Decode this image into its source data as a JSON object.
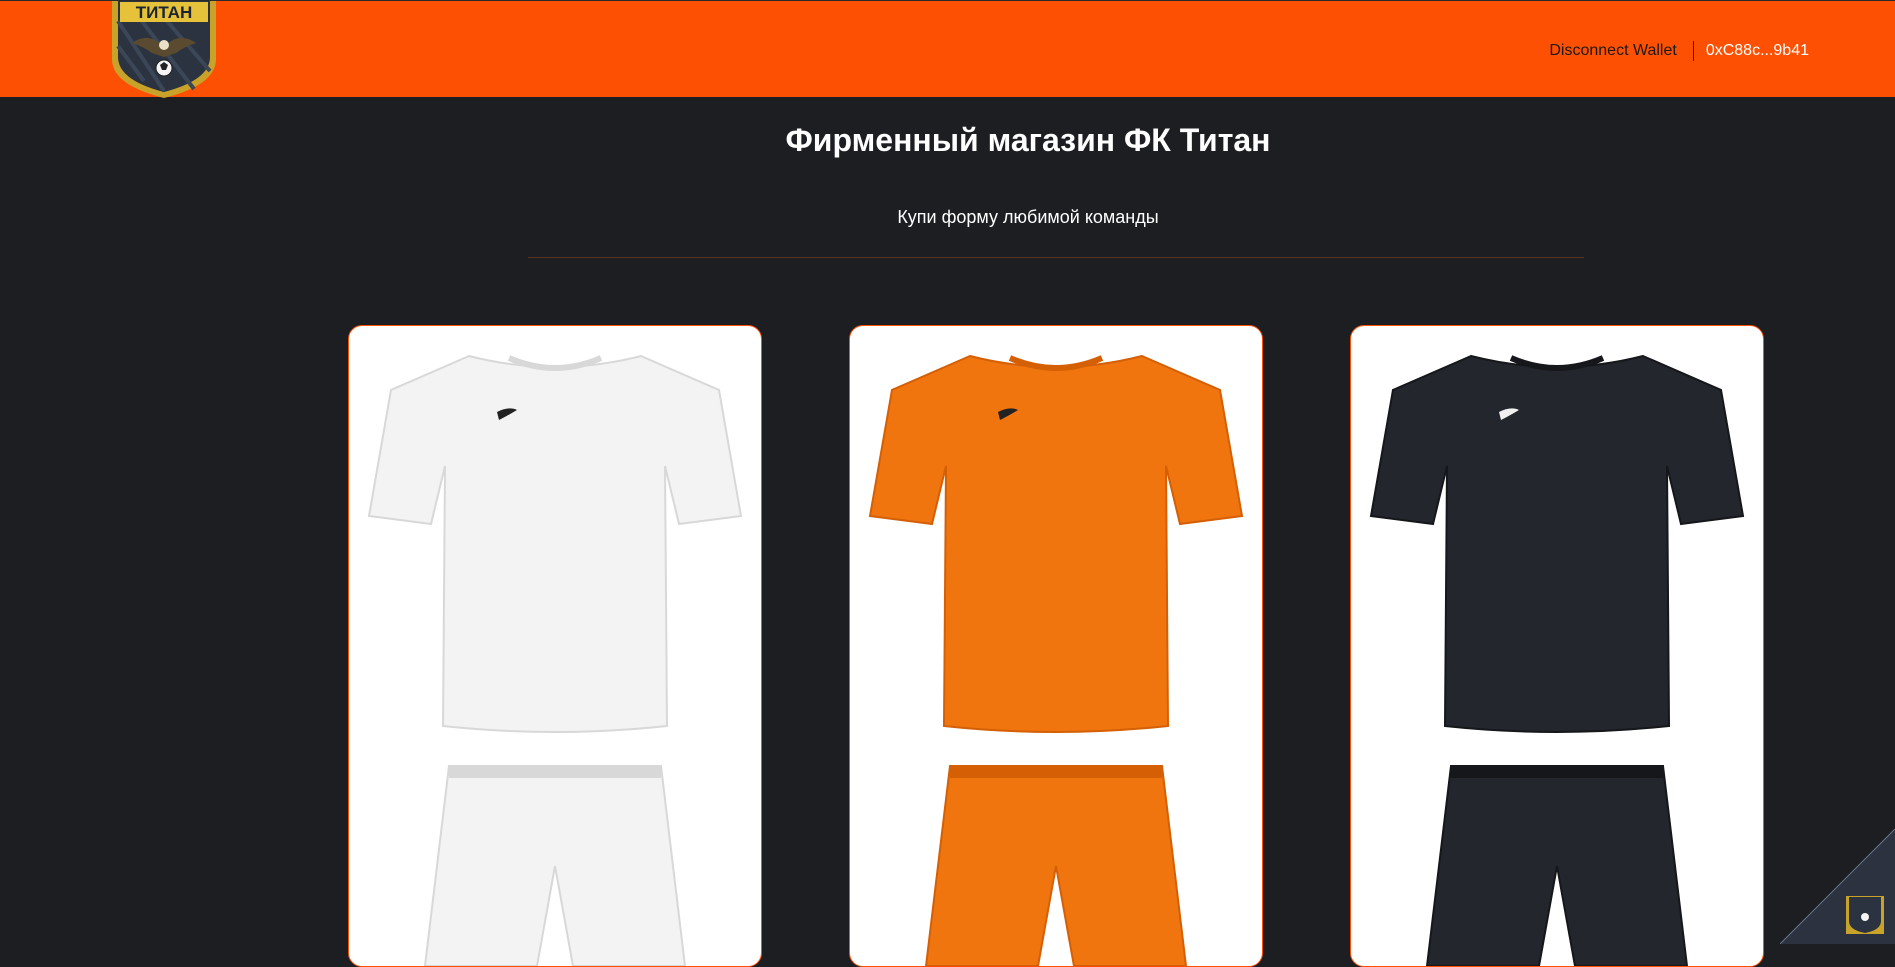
{
  "header": {
    "logo_text": "ТИТАН",
    "disconnect_label": "Disconnect Wallet",
    "wallet_address": "0xC88c...9b41"
  },
  "main": {
    "title": "Фирменный магазин ФК Титан",
    "subtitle": "Купи форму любимой команды"
  },
  "products": [
    {
      "kit_color": "#f3f3f3",
      "accent": "#d8d8d8",
      "logo_color": "#222222"
    },
    {
      "kit_color": "#f0750f",
      "accent": "#d45f05",
      "logo_color": "#222222"
    },
    {
      "kit_color": "#23262d",
      "accent": "#15171b",
      "logo_color": "#f0f0f0"
    }
  ],
  "colors": {
    "header_bg": "#fe5002",
    "page_bg": "#1c1e22",
    "card_border": "#fe5002"
  }
}
